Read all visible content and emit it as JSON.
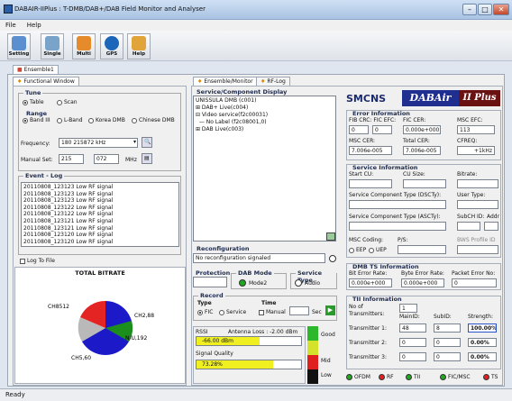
{
  "window": {
    "title": "DABAIR-IIPlus : T-DMB/DAB+/DAB Field Monitor and Analyser",
    "min": "–",
    "max": "□",
    "close": "✕"
  },
  "menu": [
    "File",
    "Help"
  ],
  "toolbar": [
    {
      "label": "Setting",
      "icon": "setting-icon",
      "color": "#5b8fd0"
    },
    {
      "label": "Single",
      "icon": "single-icon",
      "color": "#7aa3c9"
    },
    {
      "label": "Multi",
      "icon": "multi-icon",
      "color": "#e68b2b"
    },
    {
      "label": "GPS",
      "icon": "gps-icon",
      "color": "#1b66b8"
    },
    {
      "label": "Help",
      "icon": "help-icon",
      "color": "#e0a43a"
    }
  ],
  "ensemble_tab": "Ensemble1",
  "left_tab": "Functional Window",
  "tune": {
    "title": "Tune",
    "table": "Table",
    "scan": "Scan",
    "range_title": "Range",
    "ranges": [
      "Band III",
      "L-Band",
      "Korea DMB",
      "Chinese DMB"
    ],
    "frequency_label": "Frequency:",
    "frequency_value": "180 215872 kHz",
    "manual_label": "Manual Set:",
    "manual_mhz": "215",
    "manual_khz": "072",
    "manual_unit": "MHz"
  },
  "event_log": {
    "title": "Event - Log",
    "entries": [
      "20110808_123123  Low RF signal",
      "20110808_123123  Low RF signal",
      "20110808_123123  Low RF signal",
      "20110808_123122  Low RF signal",
      "20110808_123122  Low RF signal",
      "20110808_123121  Low RF signal",
      "20110808_123121  Low RF signal",
      "20110808_123120  Low RF signal",
      "20110808_123120  Low RF signal"
    ],
    "log_to_file": "Log To File"
  },
  "bitrate": {
    "title": "TOTAL BITRATE",
    "labels": [
      "CH8512",
      "CH2,88",
      "N/U,192",
      "CH5,60"
    ]
  },
  "mid_tabs": [
    "Ensemble/Monitor",
    "RF-Log"
  ],
  "service_display": {
    "title": "Service/Component Display",
    "tree": [
      "UNISSULA DMB (c001)",
      "⊞ DAB+ Live(c004)",
      "⊟ Video service(f2c00031)",
      "  — No Label (f2c08001,0)",
      "⊞ DAB Live(c003)"
    ]
  },
  "reconfig": {
    "title": "Reconfiguration",
    "text": "No reconfiguration signaled"
  },
  "protection": {
    "title": "Protection"
  },
  "dab_mode": {
    "title": "DAB Mode",
    "value": "Mode2"
  },
  "service_type": {
    "title": "Service Type",
    "value": "Audio"
  },
  "record": {
    "title": "Record",
    "type_label": "Type",
    "fic": "FIC",
    "service": "Service",
    "time_label": "Time",
    "manual": "Manual",
    "sec": "Sec"
  },
  "rssi": {
    "label": "RSSI",
    "antenna_loss": "Antenna Loss : -2.00 dBm",
    "value": "-66.00 dBm",
    "fill": 0.6,
    "quality_label": "Signal Quality",
    "quality_value": "73.28%",
    "quality_fill": 0.73,
    "scale": [
      "Good",
      "Mid",
      "Low"
    ]
  },
  "logo": {
    "brand": "SMCNS",
    "product1": "DABAir",
    "product2": "II Plus"
  },
  "error_info": {
    "title": "Error Information",
    "fib_label": "FIB CRC: FIC EFC:",
    "fib_values": [
      "0",
      "0"
    ],
    "fic_cer_label": "FIC CER:",
    "fic_cer_value": "0.000e+000",
    "msc_efc_label": "MSC EFC:",
    "msc_efc_value": "113",
    "msc_cer_label": "MSC CER:",
    "msc_cer_value": "7.006e-005",
    "total_cer_label": "Total CER:",
    "total_cer_value": "7.006e-005",
    "cfreq_label": "CFREQ:",
    "cfreq_value": "+1kHz"
  },
  "service_info": {
    "title": "Service Information",
    "start_cu": "Start CU:",
    "cu_size": "CU Size:",
    "bitrate": "Bitrate:",
    "dscty": "Service Component Type (DSCTy):",
    "user_type": "User Type:",
    "ascty": "Service Component Type (ASCTy):",
    "subch_id": "SubCH ID:",
    "addr": "Addr",
    "msc_coding": "MSC Coding:",
    "ps": "P/S:",
    "eep": "EEP",
    "uep": "UEP",
    "bws_profile": "BWS Profile ID"
  },
  "dmb_ts": {
    "title": "DMB TS Information",
    "bit_error": "Bit Error Rate:",
    "byte_error": "Byte Error Rate:",
    "packet_error": "Packet Error No:",
    "bit_value": "0.000e+000",
    "byte_value": "0.000e+000",
    "packet_value": "0"
  },
  "tii": {
    "title": "TII Information",
    "no_of": "No of",
    "transmitters": "Transmitters:",
    "count": "1",
    "mainid": "MainID:",
    "subid": "SubID:",
    "strength": "Strength:",
    "rows": [
      {
        "label": "Transmitter 1:",
        "main": "48",
        "sub": "8",
        "strength": "100.00%"
      },
      {
        "label": "Transmitter 2:",
        "main": "0",
        "sub": "0",
        "strength": "0.00%"
      },
      {
        "label": "Transmitter 3:",
        "main": "0",
        "sub": "0",
        "strength": "0.00%"
      }
    ]
  },
  "indicators": [
    "OFDM",
    "RF",
    "TII",
    "FIC/MSC",
    "TS"
  ],
  "status": {
    "text": "Ready"
  }
}
